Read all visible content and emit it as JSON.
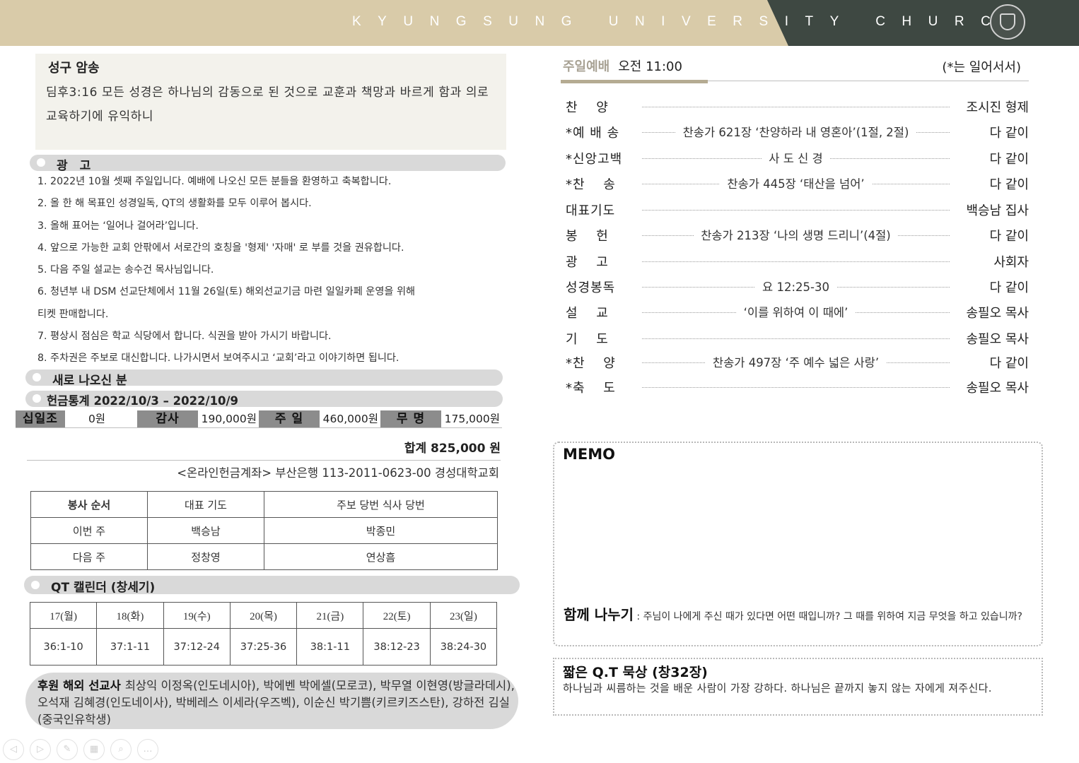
{
  "header": {
    "title": "KYUNGSUNG UNIVERSITY CHURCH"
  },
  "verse": {
    "title": "성구 암송",
    "text": "딤후3:16 모든 성경은 하나님의 감동으로 된 것으로 교훈과 책망과 바르게 함과 의로 교육하기에 유익하니"
  },
  "announcements": {
    "title": "광　고",
    "items": [
      "1. 2022년 10월 셋째 주일입니다. 예배에 나오신 모든 분들을 환영하고 축복합니다.",
      "2. 올 한 해 목표인 성경일독, QT의 생활화를 모두 이루어 봅시다.",
      "3. 올해 표어는 ‘일어나 걸어라’입니다.",
      "4. 앞으로 가능한 교회 안팎에서 서로간의 호칭을 '형제' '자매' 로 부를 것을 권유합니다.",
      "5. 다음 주일 설교는 송수건 목사님입니다.",
      "6. 청년부 내 DSM 선교단체에서 11월 26일(토) 해외선교기금 마련 일일카페 운영을 위해",
      "티켓 판매합니다.",
      "7. 평상시 점심은 학교 식당에서 합니다. 식권을 받아 가시기 바랍니다.",
      "8. 주차권은 주보로 대신합니다. 나가시면서 보여주시고 ‘교회’라고 이야기하면 됩니다."
    ]
  },
  "newcomers": {
    "title": "새로 나오신 분"
  },
  "offering": {
    "title": "헌금통계 2022/10/3 – 2022/10/9",
    "items": [
      {
        "label": "십일조",
        "value": "0원"
      },
      {
        "label": "감사",
        "value": "190,000원"
      },
      {
        "label": "주 일",
        "value": "460,000원"
      },
      {
        "label": "무 명",
        "value": "175,000원"
      }
    ],
    "total": "합계  825,000 원",
    "account": "<온라인헌금계좌> 부산은행 113-2011-0623-00 경성대학교회"
  },
  "service_table": {
    "headers": [
      "봉사 순서",
      "대표 기도",
      "주보 당번 식사 당번"
    ],
    "rows": [
      [
        "이번 주",
        "백승남",
        "박종민"
      ],
      [
        "다음 주",
        "정창영",
        "연상흠"
      ]
    ]
  },
  "qt_calendar": {
    "title": "QT 캘린더 (창세기)",
    "days": [
      "17(월)",
      "18(화)",
      "19(수)",
      "20(목)",
      "21(금)",
      "22(토)",
      "23(일)"
    ],
    "refs": [
      "36:1-10",
      "37:1-11",
      "37:12-24",
      "37:25-36",
      "38:1-11",
      "38:12-23",
      "38:24-30"
    ]
  },
  "missionaries": {
    "label": "후원 해외 선교사",
    "text": "최상익 이정옥(인도네시아), 박에벤 박에셀(모로코), 박무열 이현영(방글라데시), 오석재 김혜경(인도네이사), 박베레스 이세라(우즈벡), 이순신 박기쁨(키르키즈스탄), 강하전 김실(중국인유학생)"
  },
  "worship": {
    "title": "주일예배",
    "time": "오전 11:00",
    "note": "(*는 일어서서)",
    "items": [
      {
        "item": "찬　 양",
        "detail": "",
        "leader": "조시진 형제"
      },
      {
        "item": "*예 배 송",
        "detail": "찬송가 621장 ‘찬양하라 내 영혼아’(1절, 2절)",
        "leader": "다 같이"
      },
      {
        "item": "*신앙고백",
        "detail": "사 도 신 경",
        "leader": "다 같이"
      },
      {
        "item": "*찬　 송",
        "detail": "찬송가 445장 ‘태산을 넘어’",
        "leader": "다 같이"
      },
      {
        "item": "대표기도",
        "detail": "",
        "leader": "백승남 집사"
      },
      {
        "item": "봉　 헌",
        "detail": "찬송가 213장 ‘나의 생명 드리니’(4절)",
        "leader": "다 같이"
      },
      {
        "item": "광　 고",
        "detail": "",
        "leader": "사회자"
      },
      {
        "item": "성경봉독",
        "detail": "요 12:25-30",
        "leader": "다 같이"
      },
      {
        "item": "설　 교",
        "detail": "‘이를 위하여 이 때에’",
        "leader": "송필오 목사"
      },
      {
        "item": "기　 도",
        "detail": "",
        "leader": "송필오 목사"
      },
      {
        "item": "*찬　 양",
        "detail": "찬송가 497장  ‘주 예수 넓은 사랑’",
        "leader": "다 같이"
      },
      {
        "item": "*축　 도",
        "detail": "",
        "leader": "송필오 목사"
      }
    ]
  },
  "memo": {
    "title": "MEMO",
    "share_label": "함께 나누기",
    "share_text": " : 주님이 나에게 주신 때가 있다면 어떤 때입니까? 그 때를 위하여 지금 무엇을 하고 있습니까?"
  },
  "short_qt": {
    "title": "짧은 Q.T 묵상 (창32장)",
    "text": "하나님과 씨름하는 것을 배운 사람이 가장 강하다. 하나님은 끝까지 놓지 않는 자에게 져주신다."
  },
  "viewer_controls": [
    "prev-icon",
    "next-icon",
    "pen-icon",
    "slides-icon",
    "zoom-icon",
    "more-icon"
  ]
}
